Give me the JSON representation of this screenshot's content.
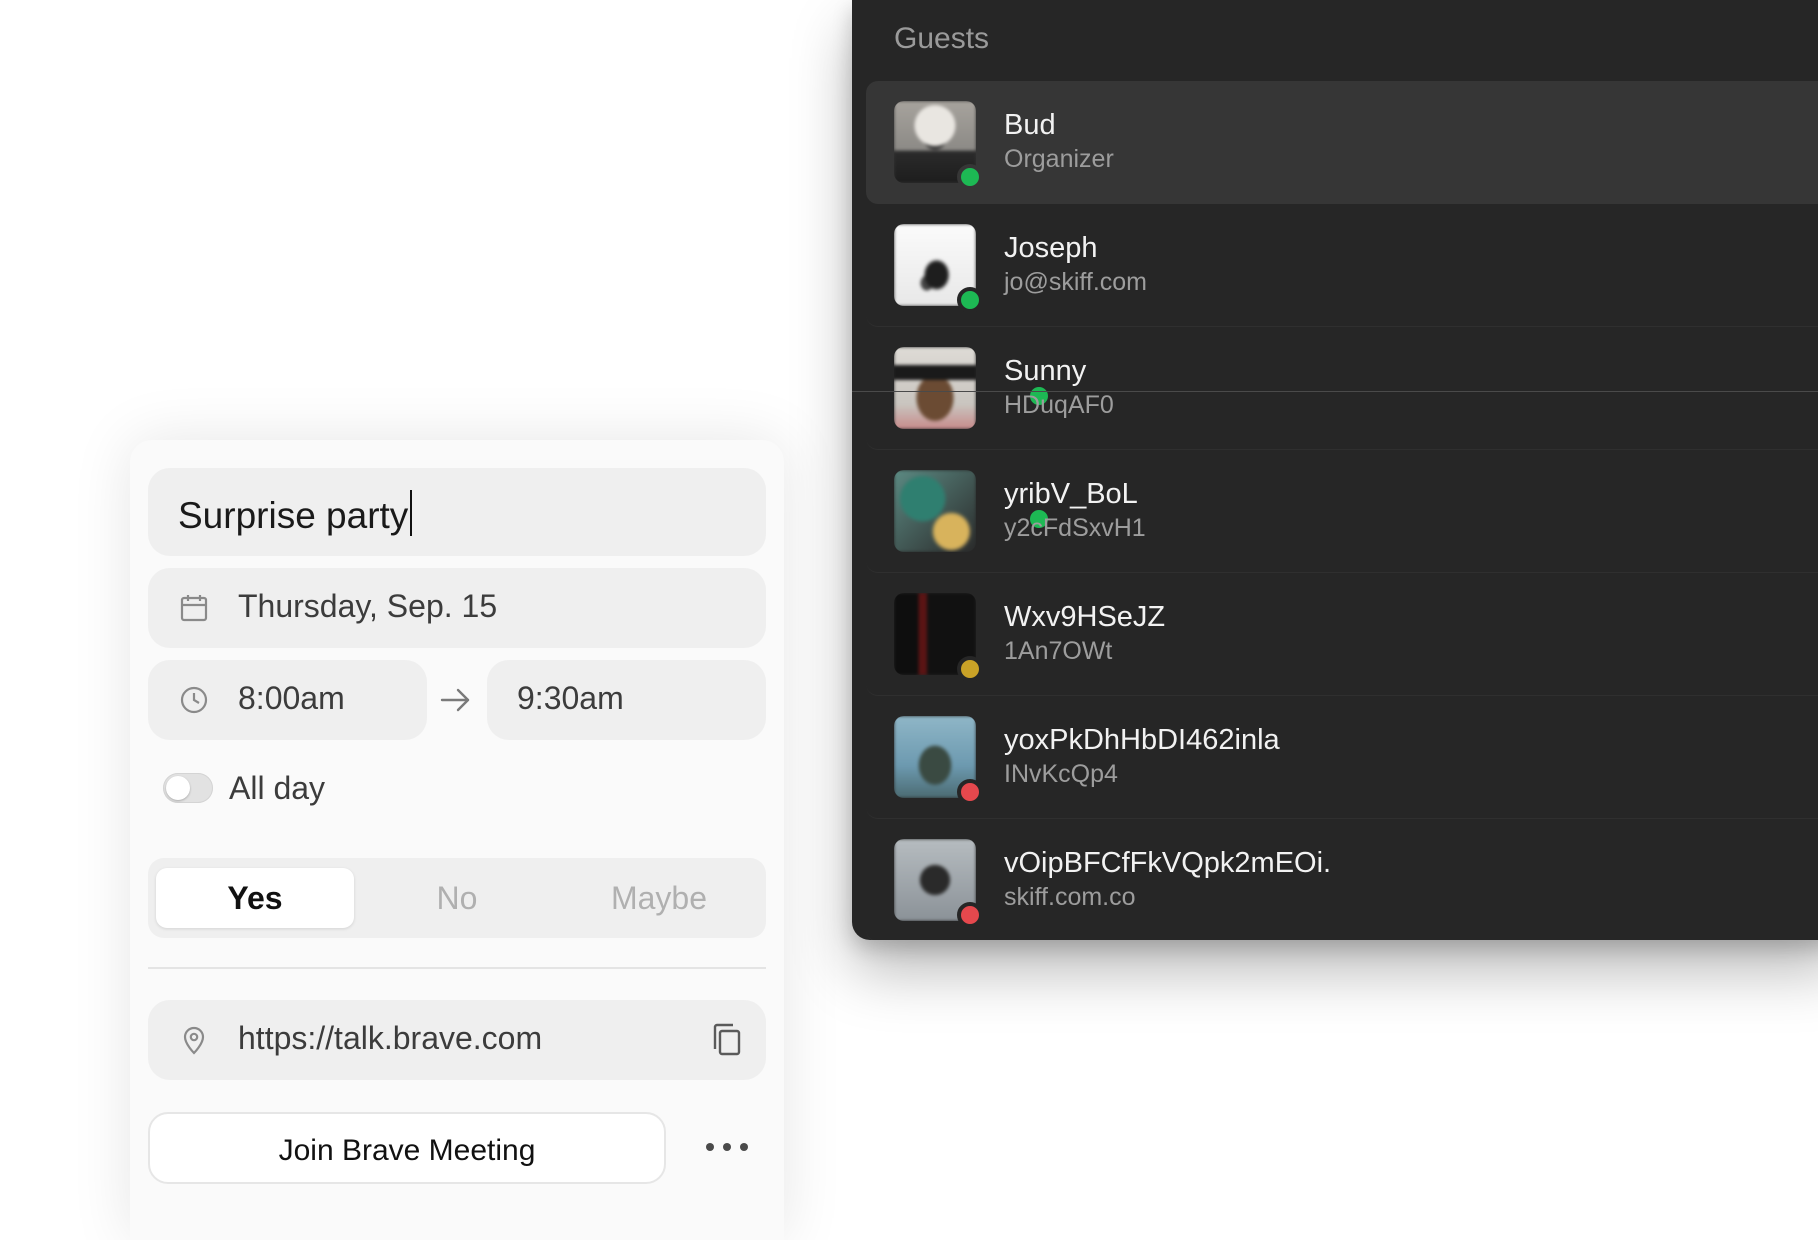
{
  "guests": {
    "title": "Guests",
    "items": [
      {
        "name": "Bud",
        "subtitle": "Organizer",
        "status": "online",
        "status_color": "#1db954",
        "avatar_colors": [
          "#8c8a86",
          "#e9e6e1"
        ],
        "selected": true
      },
      {
        "name": "Joseph",
        "subtitle": "jo@skiff.com",
        "status": "online",
        "status_color": "#1db954",
        "avatar_colors": [
          "#f4f4f4",
          "#1e1e1e"
        ],
        "selected": false
      },
      {
        "name": "Sunny",
        "subtitle": "HDuqAF0",
        "status": "online",
        "status_color": "#1db954",
        "avatar_colors": [
          "#d6d2cc",
          "#6b4b33"
        ],
        "selected": false
      },
      {
        "name": "yribV_BoL",
        "subtitle": "y2cFdSxvH1",
        "status": "online",
        "status_color": "#1db954",
        "avatar_colors": [
          "#3f8a7c",
          "#d8b35c"
        ],
        "selected": false
      },
      {
        "name": "Wxv9HSeJZ",
        "subtitle": "1An7OWt",
        "status": "away",
        "status_color": "#c9a227",
        "avatar_colors": [
          "#121212",
          "#8b1a1a"
        ],
        "selected": false
      },
      {
        "name": "yoxPkDhHbDI462inla",
        "subtitle": "INvKcQp4",
        "status": "busy",
        "status_color": "#e5484d",
        "avatar_colors": [
          "#6d9ab0",
          "#3a4a42"
        ],
        "selected": false
      },
      {
        "name": "vOipBFCfFkVQpk2mEOi.",
        "subtitle": "skiff.com.co",
        "status": "busy",
        "status_color": "#e5484d",
        "avatar_colors": [
          "#9aa2a8",
          "#2a2a2a"
        ],
        "selected": false
      }
    ]
  },
  "event": {
    "title": "Surprise party",
    "date": "Thursday, Sep. 15",
    "start_time": "8:00am",
    "end_time": "9:30am",
    "all_day_label": "All day",
    "all_day": false,
    "rsvp": {
      "options": [
        "Yes",
        "No",
        "Maybe"
      ],
      "selected": "Yes"
    },
    "location": "https://talk.brave.com",
    "join_button": "Join Brave Meeting"
  },
  "icons": {
    "date": "calendar-icon",
    "time": "clock-icon",
    "arrow": "arrow-right-icon",
    "location": "map-pin-icon",
    "copy": "copy-icon",
    "more": "more-horizontal-icon"
  }
}
